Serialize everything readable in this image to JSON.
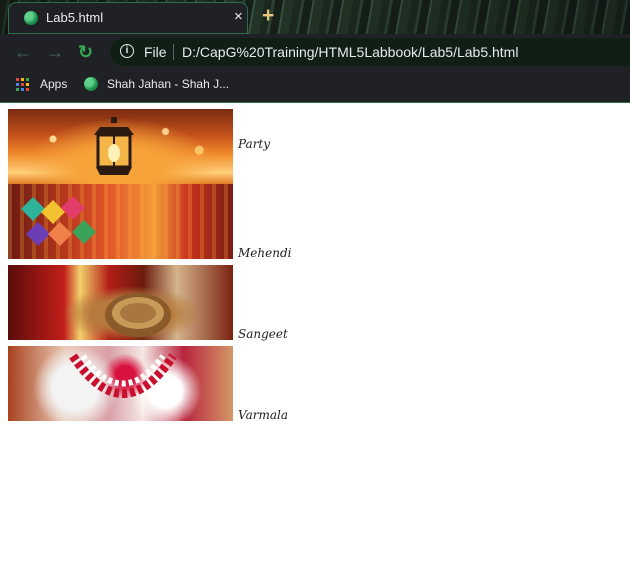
{
  "browser": {
    "tab": {
      "title": "Lab5.html",
      "close": "×"
    },
    "new_tab": "+",
    "nav": {
      "back": "←",
      "forward": "→",
      "reload": "↻"
    },
    "omnibox": {
      "info": "i",
      "scheme": "File",
      "url": "D:/CapG%20Training/HTML5Labbook/Lab5/Lab5.html"
    },
    "bookmarks": {
      "apps_label": "Apps",
      "item": "Shah Jahan - Shah J..."
    },
    "colors": {
      "chrome_bg": "#202124",
      "accent_green": "#34a853",
      "new_tab_plus": "#e8c87a"
    }
  },
  "gallery": [
    {
      "caption": "Party",
      "image": "party-lantern-photo"
    },
    {
      "caption": "Mehendi",
      "image": "mehendi-decor-photo"
    },
    {
      "caption": "Sangeet",
      "image": "sangeet-dholak-photo"
    },
    {
      "caption": "Varmala",
      "image": "varmala-garland-photo"
    }
  ]
}
